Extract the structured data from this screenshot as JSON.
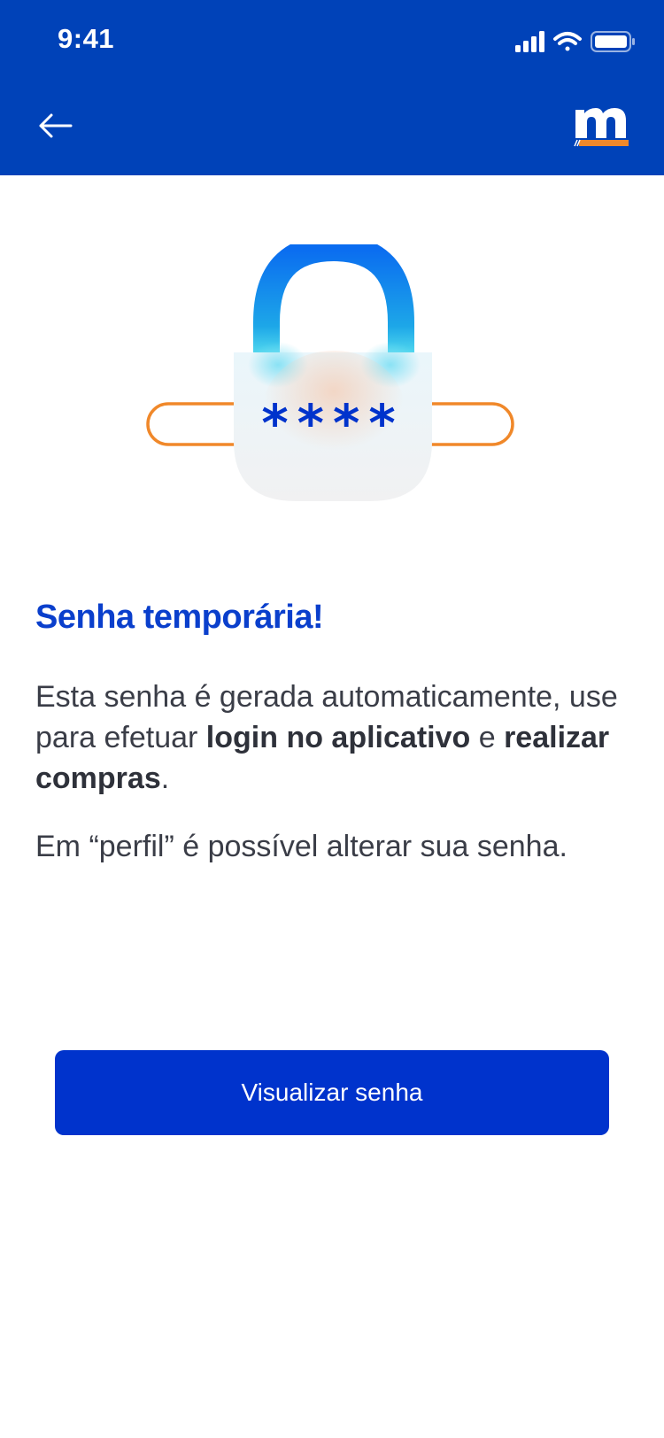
{
  "status_bar": {
    "time": "9:41",
    "icons": [
      "signal-icon",
      "wifi-icon",
      "battery-icon"
    ]
  },
  "header": {
    "back_icon": "arrow-left-icon",
    "logo_letter": "m",
    "background_color": "#0042b8"
  },
  "illustration": {
    "masked_password": "****",
    "icon": "padlock-password-icon"
  },
  "content": {
    "title": "Senha temporária!",
    "paragraph_1": {
      "text_1": "Esta senha é gerada automaticamente, use para efetuar ",
      "bold_1": "login no aplicativo",
      "text_2": " e ",
      "bold_2": "realizar compras",
      "text_3": "."
    },
    "paragraph_2": "Em “perfil” é possível alterar sua senha."
  },
  "actions": {
    "view_password_label": "Visualizar senha"
  },
  "colors": {
    "primary": "#0033cc",
    "title": "#0a3fcc",
    "accent_orange": "#f0882a",
    "text": "#3a3d47"
  }
}
